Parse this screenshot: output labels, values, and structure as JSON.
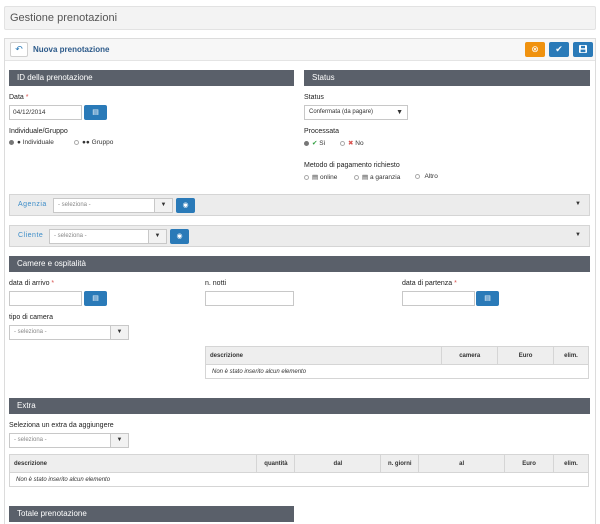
{
  "header": {
    "title": "Gestione prenotazioni"
  },
  "panel": {
    "title": "Nuova prenotazione"
  },
  "id_section": {
    "title": "ID della prenotazione",
    "data_label": "Data",
    "data_value": "04/12/2014",
    "type_label": "Individuale/Gruppo",
    "opt_individuale": "Individuale",
    "opt_gruppo": "Gruppo"
  },
  "status_section": {
    "title": "Status",
    "status_label": "Status",
    "status_value": "Confermata (da pagare)",
    "processata_label": "Processata",
    "opt_si": "Sì",
    "opt_no": "No",
    "metodo_label": "Metodo di pagamento richiesto",
    "opt_online": "online",
    "opt_garanzia": "a garanzia",
    "opt_altro": "Altro"
  },
  "agenzia": {
    "label": "Agenzia",
    "placeholder": "- seleziona -"
  },
  "cliente": {
    "label": "Cliente",
    "placeholder": "- seleziona -"
  },
  "camere": {
    "title": "Camere e ospitalità",
    "arrivo_label": "data di arrivo",
    "notti_label": "n. notti",
    "partenza_label": "data di partenza",
    "tipo_label": "tipo di camera",
    "tipo_placeholder": "- seleziona -",
    "table_headers": [
      "descrizione",
      "camera",
      "Euro",
      "elim."
    ],
    "empty_text": "Non è stato inserito alcun elemento"
  },
  "extra": {
    "title": "Extra",
    "select_label": "Seleziona un extra da aggiungere",
    "select_placeholder": "- seleziona -",
    "table_headers": [
      "descrizione",
      "quantità",
      "dal",
      "n. giorni",
      "al",
      "Euro",
      "elim."
    ],
    "empty_text": "Non è stato inserito alcun elemento"
  },
  "totale": {
    "title": "Totale prenotazione"
  }
}
